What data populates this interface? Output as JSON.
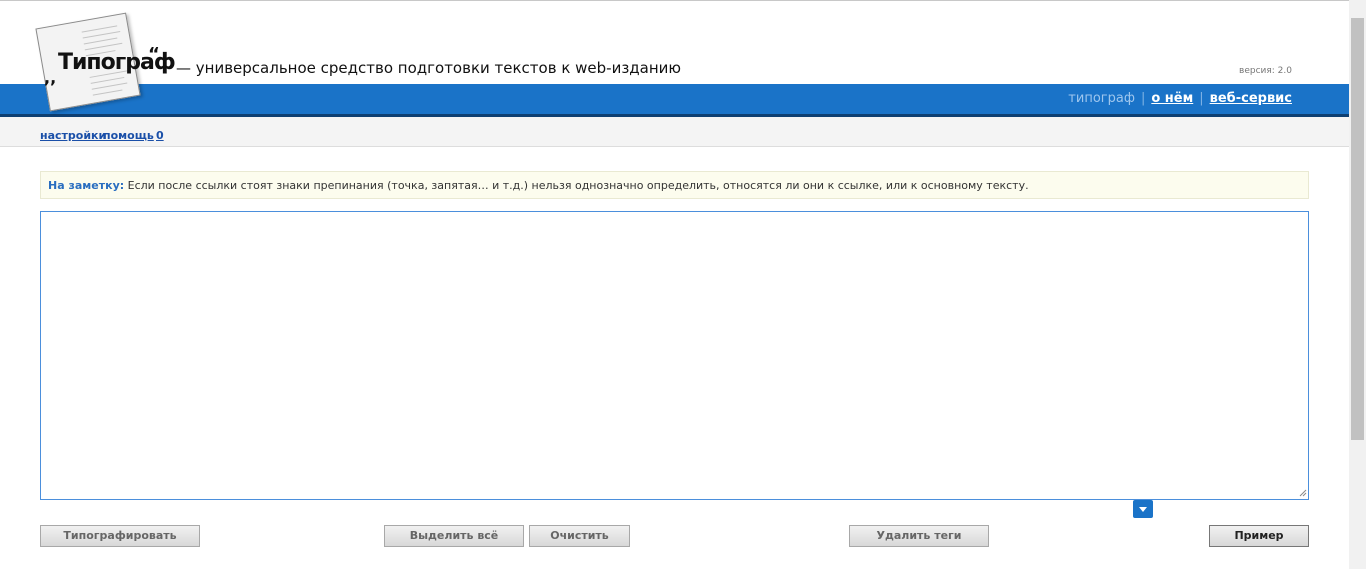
{
  "header": {
    "logo_text": "Типограф",
    "logo_quote_left": ",,",
    "logo_quote_right": "“",
    "tagline": "— универсальное средство подготовки текстов к web-изданию",
    "version": "версия: 2.0",
    "nav": {
      "current": "типограф",
      "separator": "|",
      "about": "о нём",
      "webservice": "веб-сервис"
    }
  },
  "toolbar": {
    "settings": "настройки",
    "help": "помощь",
    "counter": "0"
  },
  "notice": {
    "label": "На заметку:",
    "text": " Если после ссылки стоят знаки препинания (точка, запятая… и т.д.) нельзя однозначно определить, относятся ли они к ссылке, или к основному тексту."
  },
  "editor": {
    "value": ""
  },
  "buttons": {
    "typograph": "Типографировать",
    "select_all": "Выделить всё",
    "clear": "Очистить",
    "remove_tags": "Удалить теги",
    "example": "Пример"
  },
  "colors": {
    "accent_blue": "#1a73c8",
    "link_blue": "#1a4fa8",
    "notice_bg": "#fcfcee"
  }
}
